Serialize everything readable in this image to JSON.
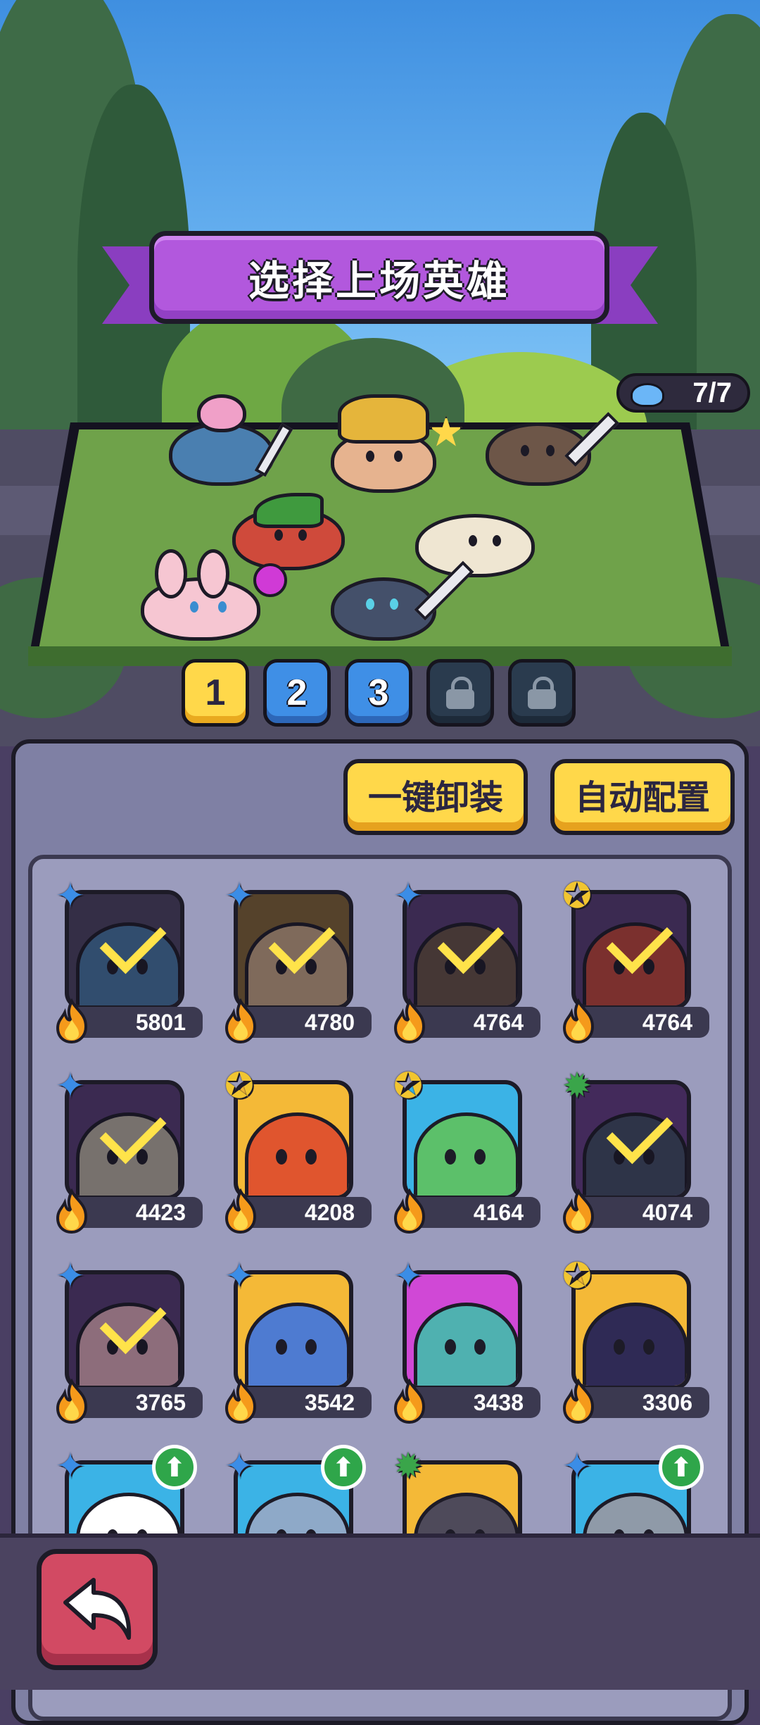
{
  "title": "选择上场英雄",
  "team_counter": {
    "value": "7/7",
    "icon": "slime-drop-icon"
  },
  "team_tabs": [
    {
      "label": "1",
      "state": "selected"
    },
    {
      "label": "2",
      "state": "available"
    },
    {
      "label": "3",
      "state": "available"
    },
    {
      "label": "",
      "state": "locked",
      "icon": "lock-icon"
    },
    {
      "label": "",
      "state": "locked",
      "icon": "lock-icon"
    }
  ],
  "buttons": {
    "unequip_all": "一键卸装",
    "auto_config": "自动配置"
  },
  "colors": {
    "accent_yellow": "#ffd84a",
    "title_purple": "#b258dd",
    "back_red": "#d24a63",
    "panel": "#7f80a4"
  },
  "heroes": [
    {
      "power": "5801",
      "rarity": "blue-rare",
      "deployed": true,
      "upgrade": false,
      "bg": "#4f4566",
      "color": "#4a7fb0"
    },
    {
      "power": "4780",
      "rarity": "blue-rare",
      "deployed": true,
      "upgrade": false,
      "bg": "#8a6a35",
      "color": "#d8b38c"
    },
    {
      "power": "4764",
      "rarity": "blue-rare",
      "deployed": true,
      "upgrade": false,
      "bg": "#5b3e7a",
      "color": "#6d5648"
    },
    {
      "power": "4764",
      "rarity": "gold-epic",
      "deployed": true,
      "upgrade": false,
      "bg": "#5b3e7a",
      "color": "#cf4a3b"
    },
    {
      "power": "4423",
      "rarity": "blue-rare",
      "deployed": true,
      "upgrade": false,
      "bg": "#5b3e7a",
      "color": "#c9bfae"
    },
    {
      "power": "4208",
      "rarity": "gold-epic",
      "deployed": false,
      "upgrade": false,
      "bg": "#f4b937",
      "color": "#e0552e"
    },
    {
      "power": "4164",
      "rarity": "gold-epic",
      "deployed": false,
      "upgrade": false,
      "bg": "#3bb3e6",
      "color": "#5cc06a"
    },
    {
      "power": "4074",
      "rarity": "green-legend",
      "deployed": true,
      "upgrade": false,
      "bg": "#6a3f8c",
      "color": "#44506a"
    },
    {
      "power": "3765",
      "rarity": "blue-rare",
      "deployed": true,
      "upgrade": false,
      "bg": "#5b3e7a",
      "color": "#f1b9c6"
    },
    {
      "power": "3542",
      "rarity": "blue-rare",
      "deployed": false,
      "upgrade": false,
      "bg": "#f4b937",
      "color": "#4e7bd1"
    },
    {
      "power": "3438",
      "rarity": "blue-rare",
      "deployed": false,
      "upgrade": false,
      "bg": "#d048d6",
      "color": "#4fb1b0"
    },
    {
      "power": "3306",
      "rarity": "gold-epic",
      "deployed": false,
      "upgrade": false,
      "bg": "#f4b937",
      "color": "#2f2a55"
    },
    {
      "power": "",
      "rarity": "blue-rare",
      "deployed": false,
      "upgrade": true,
      "bg": "#3bb3e6",
      "color": "#ffffff"
    },
    {
      "power": "",
      "rarity": "blue-rare",
      "deployed": false,
      "upgrade": true,
      "bg": "#3bb3e6",
      "color": "#8ea9c8"
    },
    {
      "power": "",
      "rarity": "green-legend",
      "deployed": false,
      "upgrade": false,
      "bg": "#f4b937",
      "color": "#4e4a5a"
    },
    {
      "power": "",
      "rarity": "blue-rare",
      "deployed": false,
      "upgrade": true,
      "bg": "#3bb3e6",
      "color": "#8f9aa8"
    }
  ],
  "footer": {
    "back_icon": "back-arrow-icon"
  }
}
